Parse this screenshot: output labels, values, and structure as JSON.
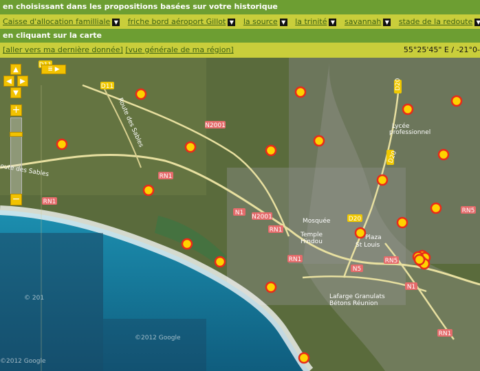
{
  "header": {
    "historique_title": "en choisissant dans les propositions basées sur votre historique",
    "carte_title": "en cliquant sur la carte"
  },
  "history": [
    {
      "label": "Caisse d'allocation familliale"
    },
    {
      "label": "friche bord aéroport Gillot"
    },
    {
      "label": "la source"
    },
    {
      "label": "la trinité"
    },
    {
      "label": "savannah"
    },
    {
      "label": "stade de la redoute"
    }
  ],
  "links": {
    "last_data": "[aller vers ma dernière donnée]",
    "region": "[vue générale de ma région]"
  },
  "coords": "55°25'45\" E / -21°0-",
  "map": {
    "road_labels": [
      "D11",
      "D11",
      "N2001",
      "RN1",
      "RN1",
      "N1",
      "N2001",
      "RN1",
      "N1",
      "D20",
      "D20",
      "D20",
      "RN1",
      "N5",
      "RN5",
      "N1",
      "RN1",
      "RN5"
    ],
    "places": {
      "route_sables_1": "Route des Sables",
      "route_sables_2": "oute des Sables",
      "lycee_1": "Lycée",
      "lycee_2": "professionnel",
      "mosquee": "Mosquée",
      "temple_1": "Temple",
      "temple_2": "Hindou",
      "plaza_1": "Plaza",
      "plaza_2": "St Louis",
      "lafarge_1": "Lafarge Granulats",
      "lafarge_2": "Bétons Réunion",
      "copyright_1": "©2012 Google",
      "copyright_2": "©2012 Google",
      "copyright_3": "© 201"
    },
    "controls": {
      "up": "▲",
      "down": "▼",
      "left": "◀",
      "right": "▶",
      "zoom_in": "+",
      "zoom_out": "−"
    },
    "marker_count": 24,
    "colors": {
      "marker_fill": "#ffd200",
      "marker_stroke": "#e82a1a",
      "header_green": "#6d9e32",
      "bar_yellow": "#c9ce3b"
    }
  }
}
